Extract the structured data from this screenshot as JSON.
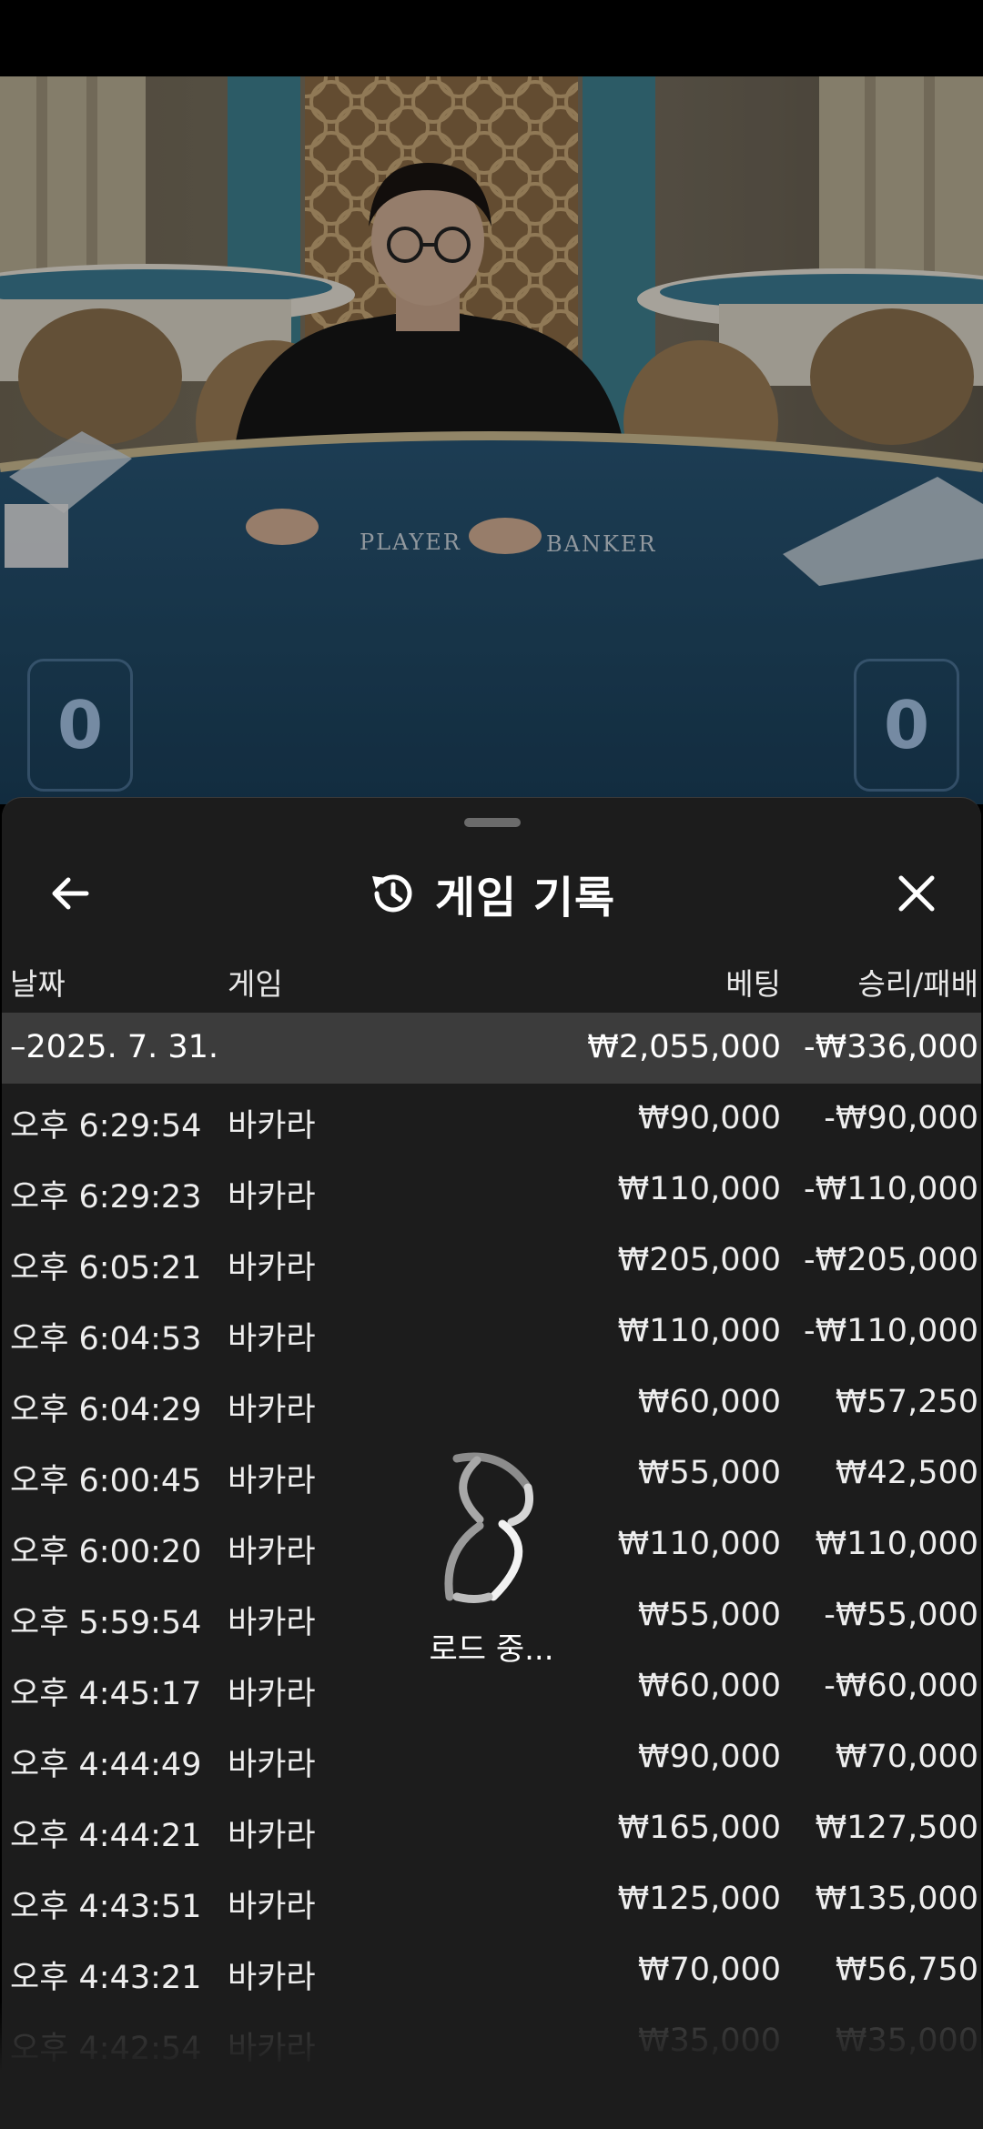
{
  "video": {
    "table_labels": [
      "PLAYER",
      "BANKER"
    ],
    "player_score": "0",
    "banker_score": "0"
  },
  "sheet": {
    "title": "게임 기록",
    "back_icon": "arrow-left-icon",
    "history_icon": "history-icon",
    "close_icon": "close-icon"
  },
  "table": {
    "headers": {
      "date": "날짜",
      "game": "게임",
      "bet": "베팅",
      "win_loss": "승리/패배"
    },
    "summary": {
      "date": "–2025. 7. 31.",
      "bet": "₩2,055,000",
      "win_loss": "-₩336,000"
    },
    "rows": [
      {
        "time": "오후 6:29:54",
        "game": "바카라",
        "bet": "₩90,000",
        "win_loss": "-₩90,000"
      },
      {
        "time": "오후 6:29:23",
        "game": "바카라",
        "bet": "₩110,000",
        "win_loss": "-₩110,000"
      },
      {
        "time": "오후 6:05:21",
        "game": "바카라",
        "bet": "₩205,000",
        "win_loss": "-₩205,000"
      },
      {
        "time": "오후 6:04:53",
        "game": "바카라",
        "bet": "₩110,000",
        "win_loss": "-₩110,000"
      },
      {
        "time": "오후 6:04:29",
        "game": "바카라",
        "bet": "₩60,000",
        "win_loss": "₩57,250"
      },
      {
        "time": "오후 6:00:45",
        "game": "바카라",
        "bet": "₩55,000",
        "win_loss": "₩42,500"
      },
      {
        "time": "오후 6:00:20",
        "game": "바카라",
        "bet": "₩110,000",
        "win_loss": "₩110,000"
      },
      {
        "time": "오후 5:59:54",
        "game": "바카라",
        "bet": "₩55,000",
        "win_loss": "-₩55,000"
      },
      {
        "time": "오후 4:45:17",
        "game": "바카라",
        "bet": "₩60,000",
        "win_loss": "-₩60,000"
      },
      {
        "time": "오후 4:44:49",
        "game": "바카라",
        "bet": "₩90,000",
        "win_loss": "₩70,000"
      },
      {
        "time": "오후 4:44:21",
        "game": "바카라",
        "bet": "₩165,000",
        "win_loss": "₩127,500"
      },
      {
        "time": "오후 4:43:51",
        "game": "바카라",
        "bet": "₩125,000",
        "win_loss": "₩135,000"
      },
      {
        "time": "오후 4:43:21",
        "game": "바카라",
        "bet": "₩70,000",
        "win_loss": "₩56,750"
      },
      {
        "time": "오후 4:42:54",
        "game": "바카라",
        "bet": "₩35,000",
        "win_loss": "₩35,000"
      }
    ]
  },
  "loading": {
    "text": "로드 중...",
    "icon": "loading-spinner-icon"
  },
  "colors": {
    "sheet_bg": "#1c1c1c",
    "summary_bg": "#3c3c3c",
    "table_felt": "#1f4866",
    "text": "#ffffff"
  }
}
